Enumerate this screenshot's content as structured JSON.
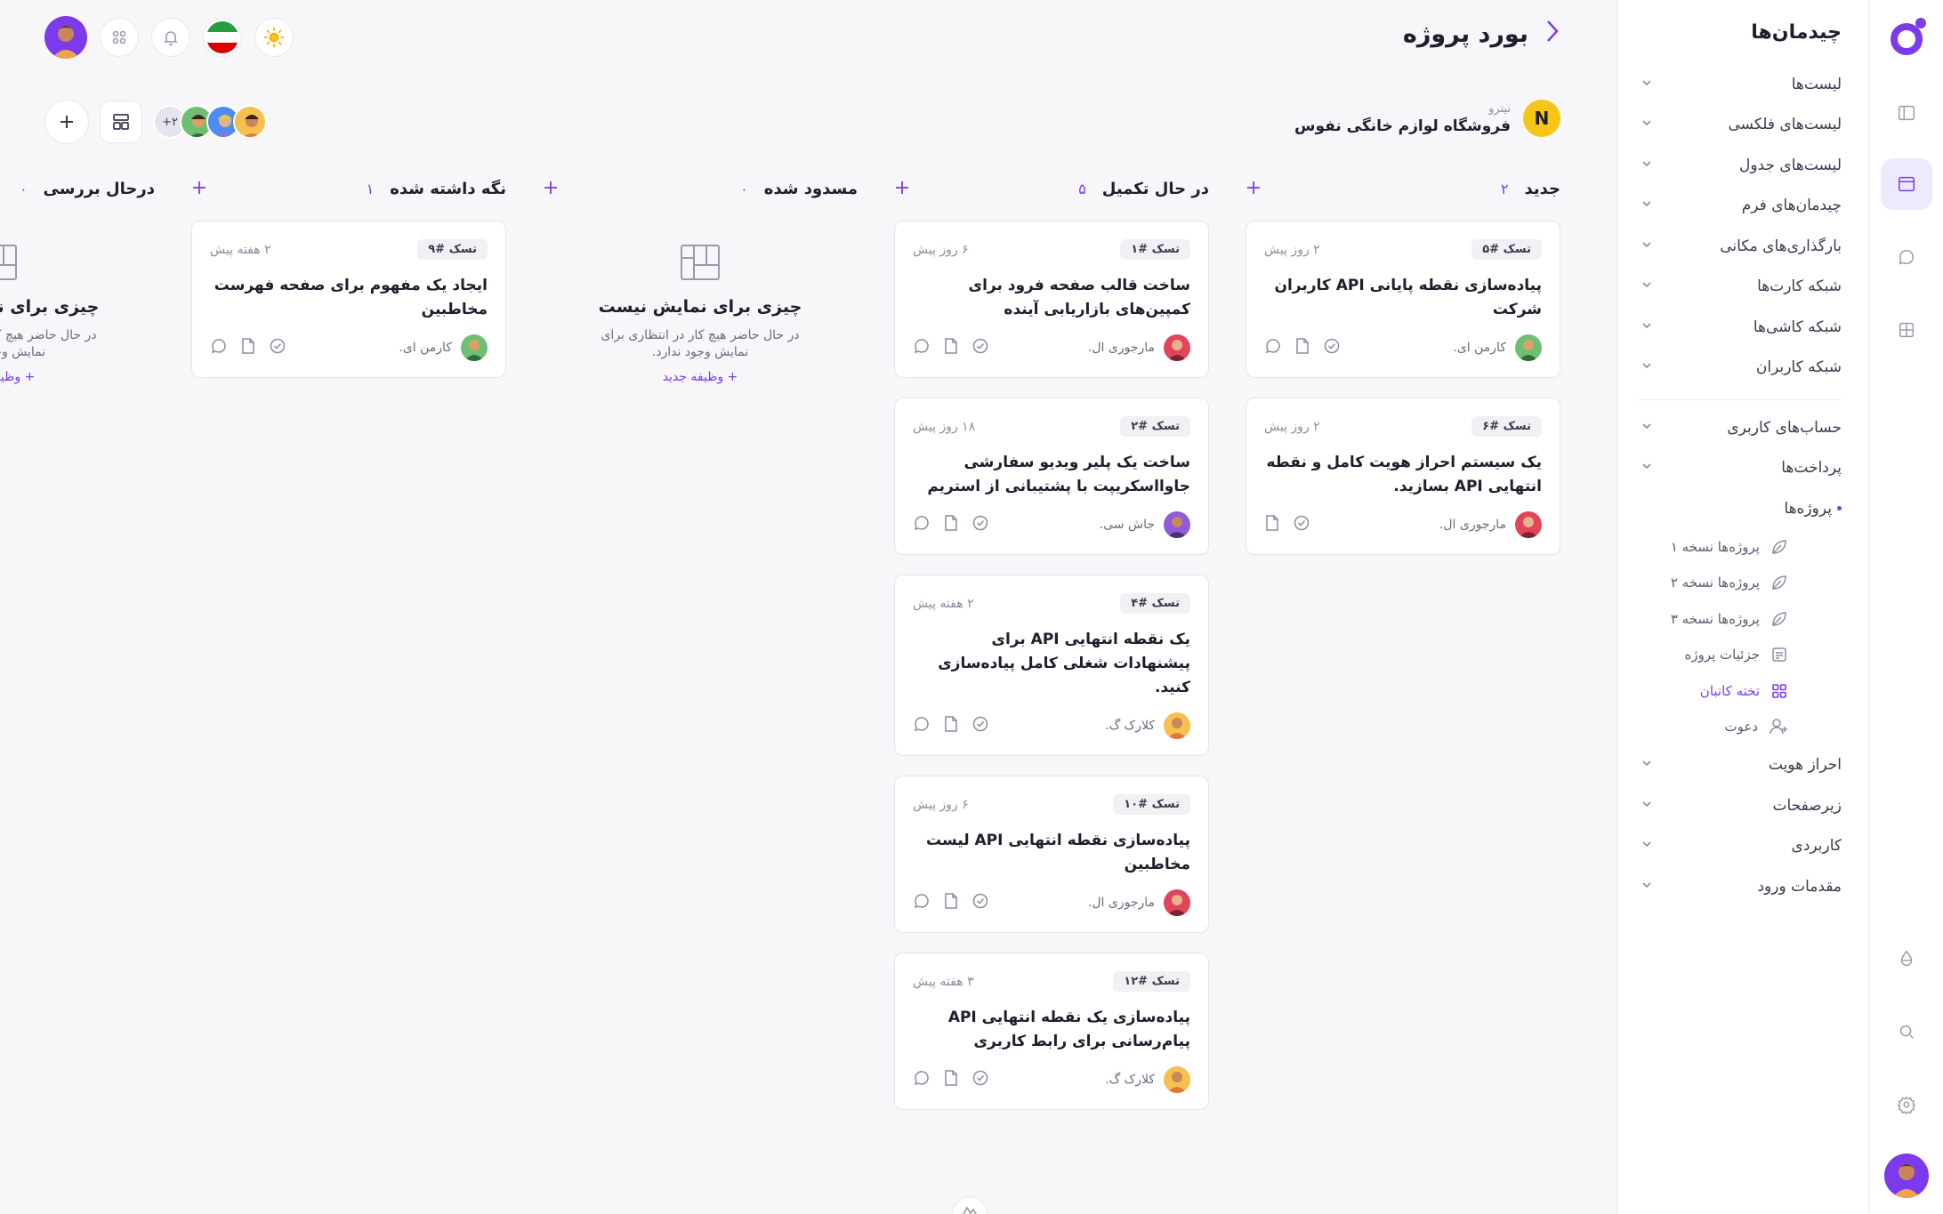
{
  "menu": {
    "title": "چیدمان‌ها",
    "items": [
      {
        "label": "لیست‌ها"
      },
      {
        "label": "لیست‌های فلکسی"
      },
      {
        "label": "لیست‌های جدول"
      },
      {
        "label": "چیدمان‌های فرم"
      },
      {
        "label": "بارگذاری‌های مکانی"
      },
      {
        "label": "شبکه کارت‌ها"
      },
      {
        "label": "شبکه کاشی‌ها"
      },
      {
        "label": "شبکه کاربران"
      }
    ],
    "items2": [
      {
        "label": "حساب‌های کاربری"
      },
      {
        "label": "پرداخت‌ها"
      },
      {
        "label": "پروژه‌ها"
      }
    ],
    "sub": [
      {
        "label": "پروژه‌ها نسخه ۱",
        "icon": "leaf-icon"
      },
      {
        "label": "پروژه‌ها نسخه ۲",
        "icon": "leaf-icon"
      },
      {
        "label": "پروژه‌ها نسخه ۳",
        "icon": "leaf-icon"
      },
      {
        "label": "جزئیات پروژه",
        "icon": "document-icon"
      },
      {
        "label": "تخته کانبان",
        "icon": "grid-icon"
      },
      {
        "label": "دعوت",
        "icon": "user-plus-icon"
      }
    ],
    "items3": [
      {
        "label": "احراز هویت"
      },
      {
        "label": "زیرصفحات"
      },
      {
        "label": "کاربردی"
      },
      {
        "label": "مقدمات ورود"
      }
    ]
  },
  "header": {
    "title": "بورد پروژه",
    "project_sub": "نیترو",
    "project_name": "فروشگاه لوازم خانگی نفوس",
    "project_logo": "N",
    "team_more": "+۲"
  },
  "columns": {
    "new": {
      "title": "جدید",
      "count": "۲",
      "cards": [
        {
          "tag": "تسک #۵",
          "time": "۲ روز پیش",
          "title": "پیاده‌سازی نقطه پایانی API کاربران شرکت",
          "assignee": "کارمن ای."
        },
        {
          "tag": "تسک #۶",
          "time": "۲ روز پیش",
          "title": "یک سیستم احراز هویت کامل و نقطه انتهایی API بسازید.",
          "assignee": "مارجوری ال."
        }
      ]
    },
    "progress": {
      "title": "در حال تکمیل",
      "count": "۵",
      "cards": [
        {
          "tag": "تسک #۱",
          "time": "۶ روز پیش",
          "title": "ساخت قالب صفحه فرود برای کمپین‌های بازاریابی آینده",
          "assignee": "مارجوری ال."
        },
        {
          "tag": "تسک #۲",
          "time": "۱۸ روز پیش",
          "title": "ساخت یک پلیر ویدیو سفارشی جاوااسکریپت با پشتیبانی از استریم",
          "assignee": "جاش سی."
        },
        {
          "tag": "تسک #۴",
          "time": "۲ هفته پیش",
          "title": "یک نقطه انتهایی API برای پیشنهادات شغلی کامل پیاده‌سازی کنید.",
          "assignee": "کلارک گ."
        },
        {
          "tag": "تسک #۱۰",
          "time": "۶ روز پیش",
          "title": "پیاده‌سازی نقطه انتهایی API لیست مخاطبین",
          "assignee": "مارجوری ال."
        },
        {
          "tag": "تسک #۱۲",
          "time": "۳ هفته پیش",
          "title": "پیاده‌سازی یک نقطه انتهایی API پیام‌رسانی برای رابط کاربری",
          "assignee": "کلارک گ."
        }
      ]
    },
    "blocked": {
      "title": "مسدود شده",
      "count": "۰",
      "empty_title": "چیزی برای نمایش نیست",
      "empty_desc": "در حال حاضر هیچ کار در انتظاری برای نمایش وجود ندارد.",
      "empty_link": "وظیفه جدید"
    },
    "onhold": {
      "title": "نگه داشته شده",
      "count": "۱",
      "cards": [
        {
          "tag": "تسک #۹",
          "time": "۲ هفته پیش",
          "title": "ایجاد یک مفهوم برای صفحه فهرست مخاطبین",
          "assignee": "کارمن ای."
        }
      ]
    },
    "review": {
      "title": "درحال بررسی",
      "count": "۰",
      "empty_title": "چیزی برای نمایش نیست",
      "empty_desc": "در حال حاضر هیچ کار در انتظاری برای نمایش وجود ندارد.",
      "empty_link": "وظیفه جدید"
    }
  },
  "colors": {
    "accent": "#7c3aed",
    "background": "#f7f7fa",
    "card": "#ffffff"
  }
}
